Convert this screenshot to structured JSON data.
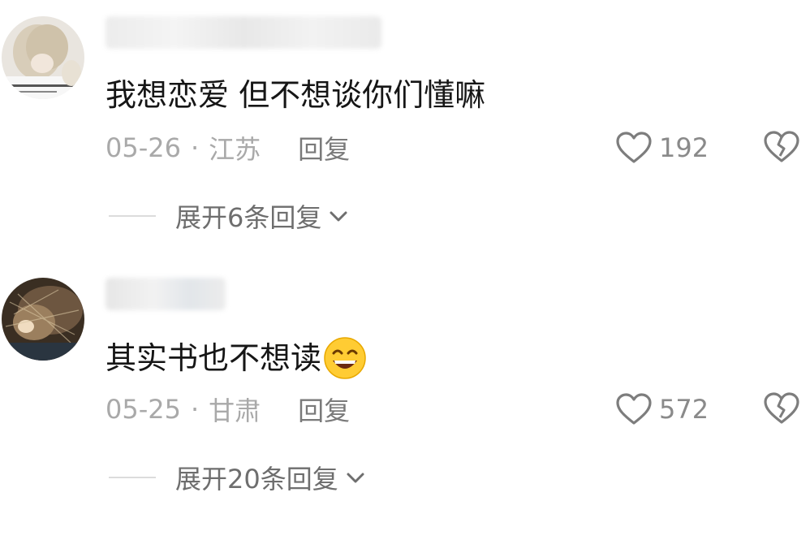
{
  "comments": [
    {
      "text": "我想恋爱 但不想谈你们懂嘛",
      "emoji": "",
      "date": "05-26",
      "separator": "·",
      "location": "江苏",
      "reply_label": "回复",
      "like_count": "192",
      "expand_label": "展开6条回复"
    },
    {
      "text": "其实书也不想读",
      "emoji": "grinning-squint-emoji",
      "date": "05-25",
      "separator": "·",
      "location": "甘肃",
      "reply_label": "回复",
      "like_count": "572",
      "expand_label": "展开20条回复"
    }
  ],
  "icons": {
    "like": "heart-outline-icon",
    "dislike": "broken-heart-icon",
    "expand": "chevron-down-icon"
  },
  "colors": {
    "text_primary": "#161616",
    "text_meta": "#a9a9a9",
    "text_secondary": "#6e6e6e",
    "icon": "#7d7d7d"
  }
}
